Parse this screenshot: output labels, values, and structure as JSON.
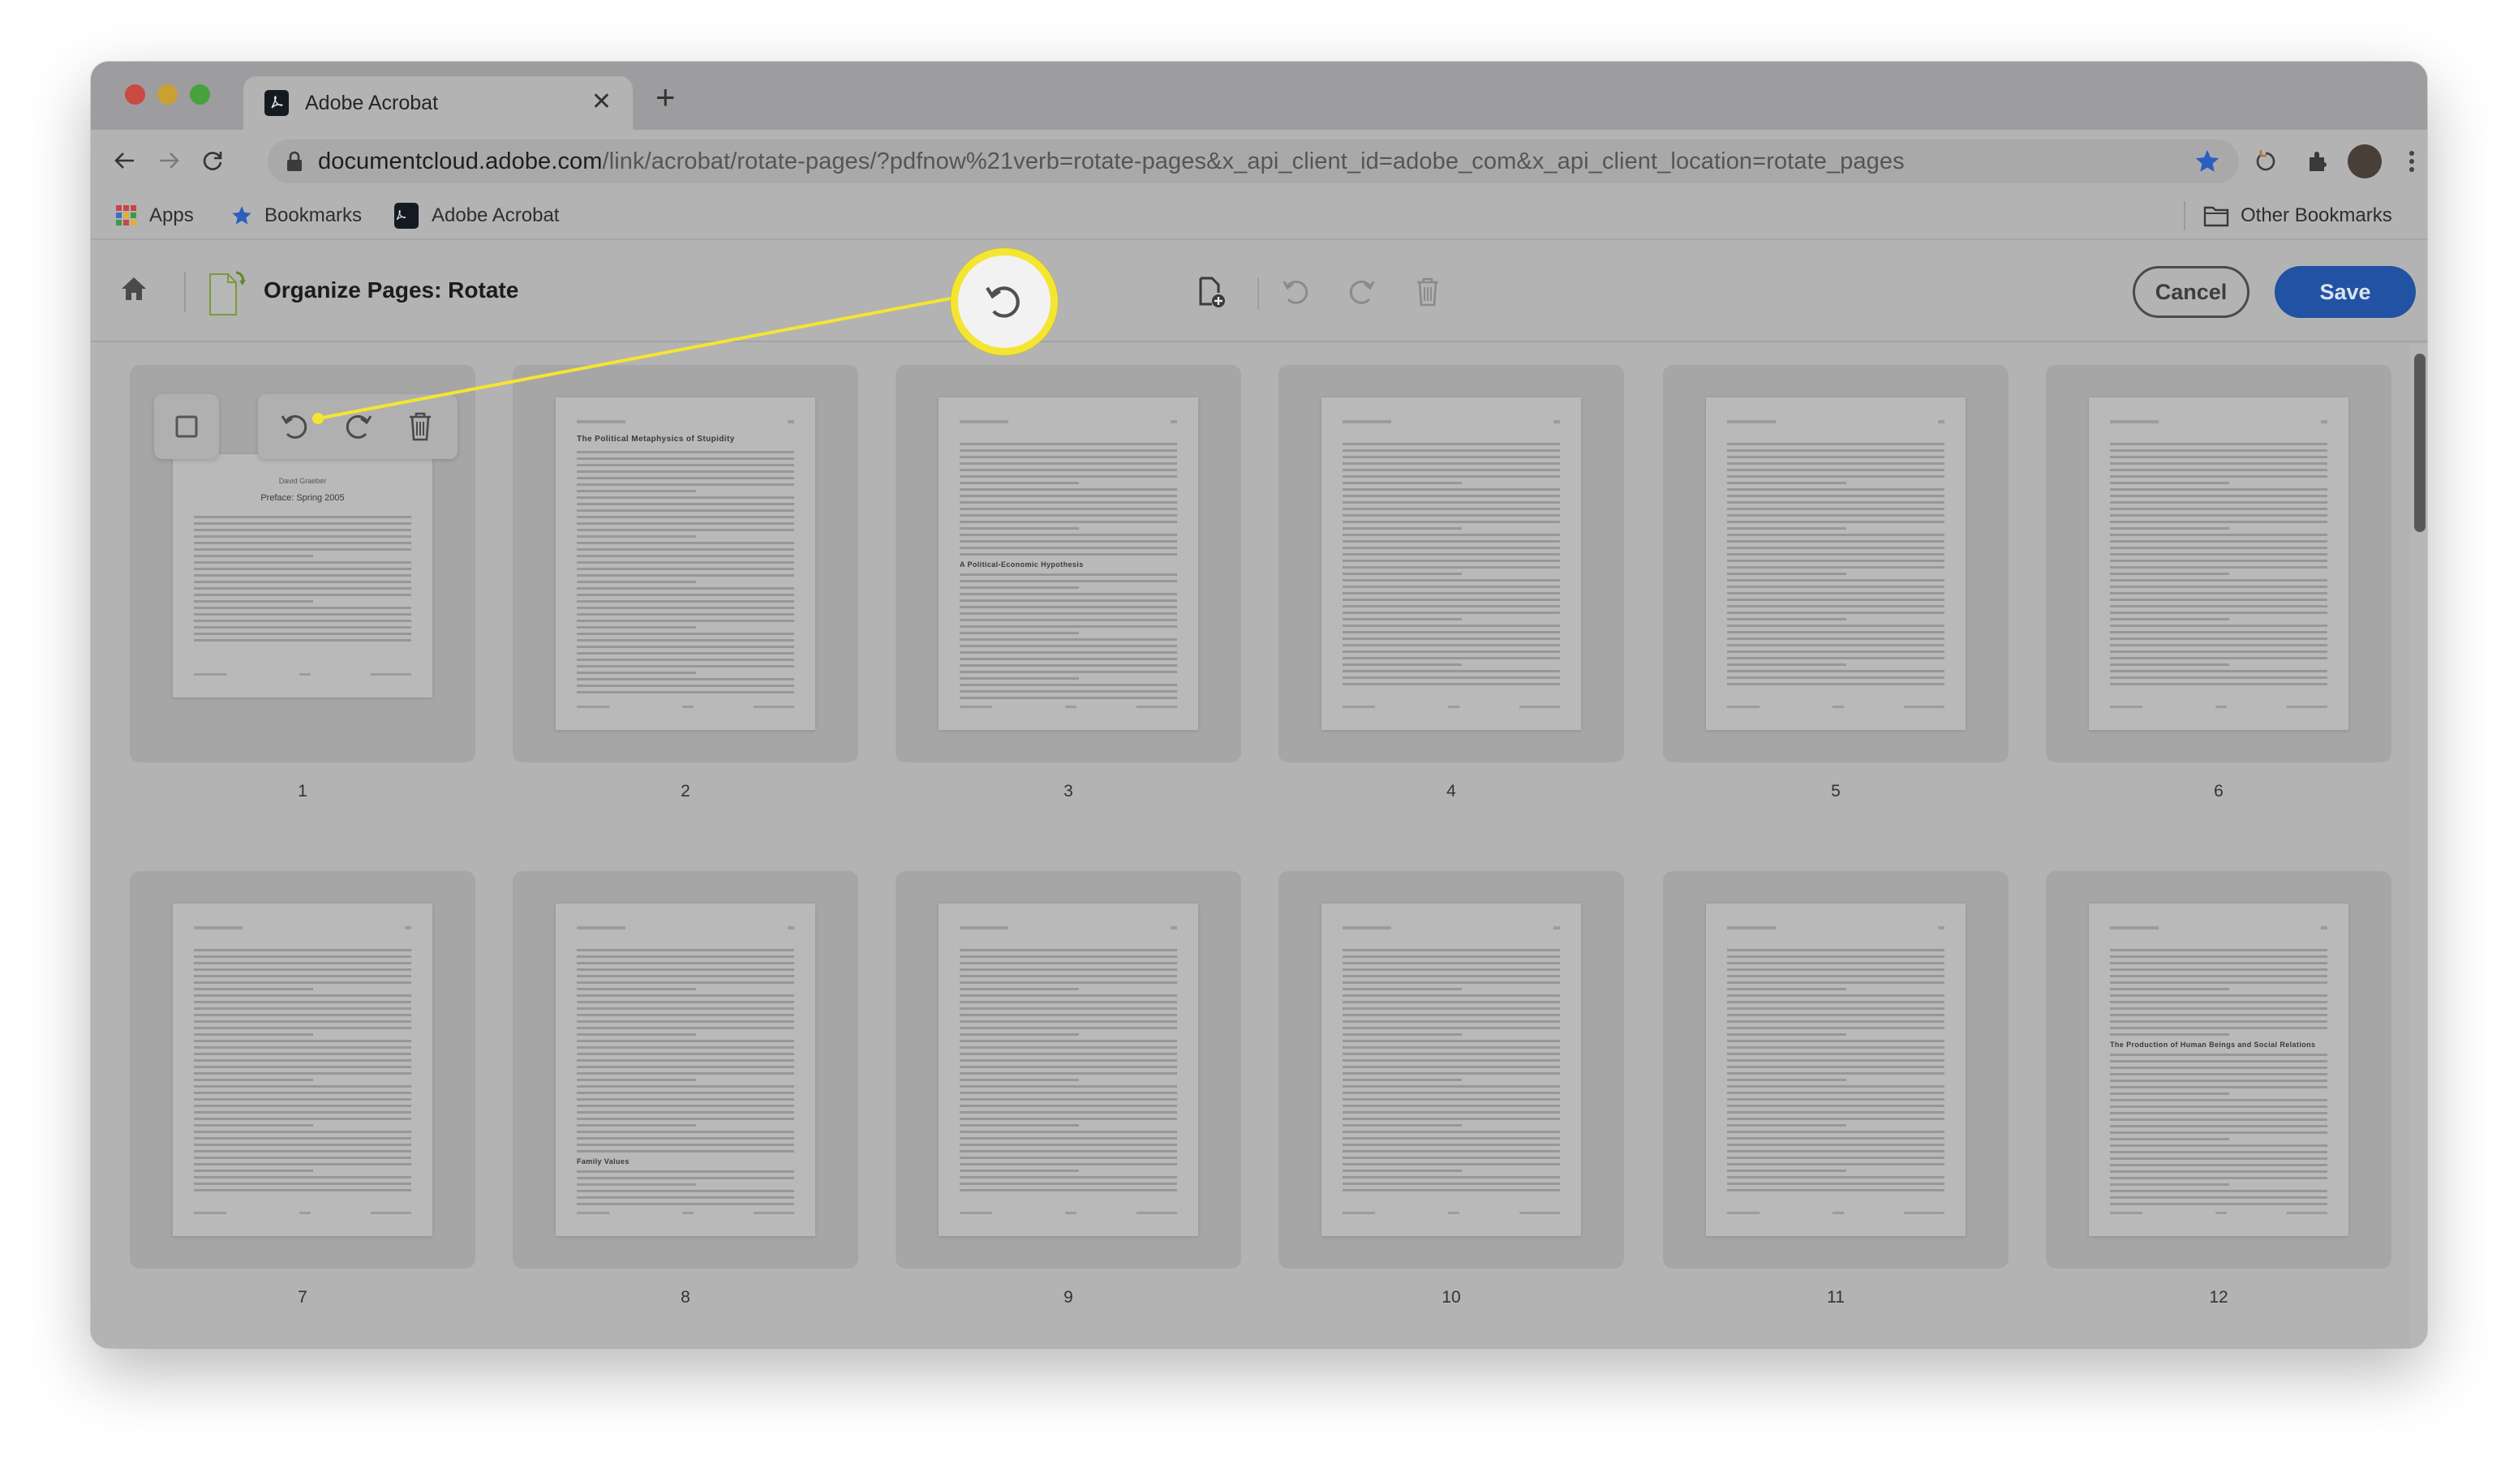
{
  "browser": {
    "tab": {
      "title": "Adobe Acrobat",
      "close_icon": "close-icon"
    },
    "new_tab_icon": "plus-icon",
    "nav": {
      "back": "arrow-left-icon",
      "forward": "arrow-right-icon",
      "reload": "reload-icon"
    },
    "url": {
      "host": "documentcloud.adobe.com",
      "path": "/link/acrobat/rotate-pages/?pdfnow%21verb=rotate-pages&x_api_client_id=adobe_com&x_api_client_location=rotate_pages"
    },
    "toolbar_icons": [
      "bookmark-star-icon",
      "history-icon",
      "extensions-icon",
      "profile-avatar",
      "menu-kebab-icon"
    ],
    "bookmarks": [
      {
        "label": "Apps",
        "icon": "apps-grid-icon"
      },
      {
        "label": "Bookmarks",
        "icon": "star-icon"
      },
      {
        "label": "Adobe Acrobat",
        "icon": "acrobat-icon"
      }
    ],
    "other_bookmarks": {
      "label": "Other Bookmarks",
      "icon": "folder-icon"
    }
  },
  "app": {
    "title": "Organize Pages: Rotate",
    "toolbar": {
      "highlighted_tool": "rotate-counterclockwise",
      "tools": [
        "insert-page",
        "rotate-counterclockwise",
        "rotate-clockwise",
        "delete"
      ]
    },
    "cancel_label": "Cancel",
    "save_label": "Save",
    "accent_color": "#2152a3",
    "highlight_color": "#f4e533"
  },
  "pages": [
    {
      "number": "1",
      "author": "David Graeber",
      "title": "Preface: Spring 2005",
      "hovered": true
    },
    {
      "number": "2",
      "title": "The Political Metaphysics of Stupidity"
    },
    {
      "number": "3",
      "section": "A Political-Economic Hypothesis"
    },
    {
      "number": "4"
    },
    {
      "number": "5"
    },
    {
      "number": "6"
    },
    {
      "number": "7"
    },
    {
      "number": "8",
      "section": "Family Values"
    },
    {
      "number": "9"
    },
    {
      "number": "10"
    },
    {
      "number": "11"
    },
    {
      "number": "12",
      "section": "The Production of Human Beings and Social Relations"
    }
  ],
  "page_hover_tools": [
    "select-checkbox",
    "rotate-counterclockwise",
    "rotate-clockwise",
    "delete"
  ]
}
